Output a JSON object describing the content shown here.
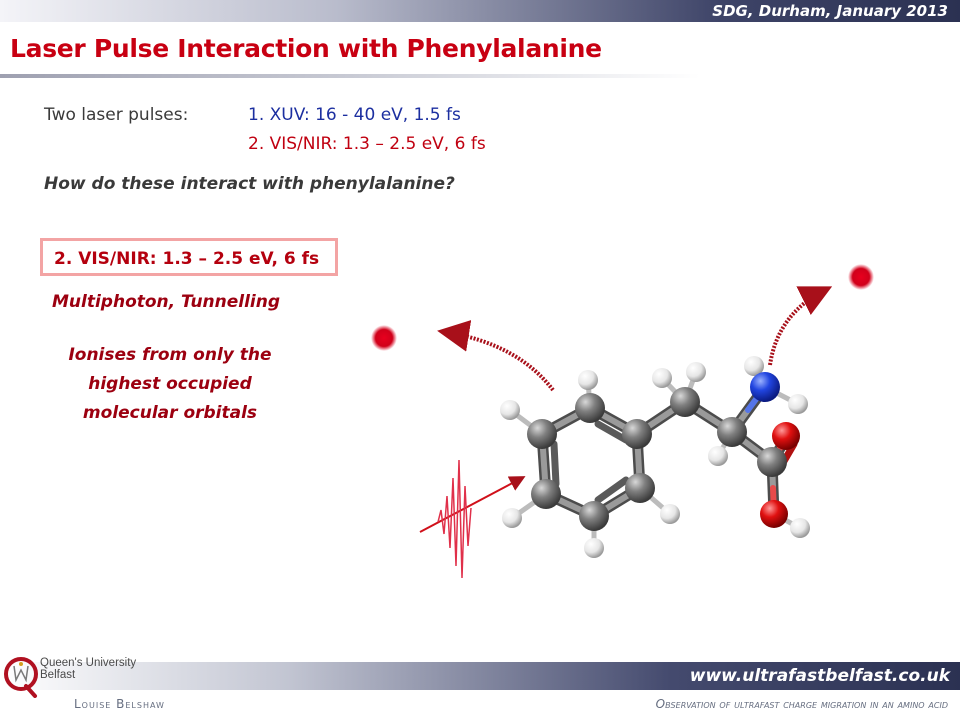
{
  "header": {
    "date_label": "SDG, Durham, January 2013"
  },
  "slide": {
    "title": "Laser Pulse Interaction with Phenylalanine",
    "pulses_label": "Two laser pulses:",
    "pulse_1": "1. XUV: 16 - 40 eV, 1.5 fs",
    "pulse_2": "2. VIS/NIR: 1.3 – 2.5 eV, 6 fs",
    "question": "How do these interact with phenylalanine?",
    "highlight": "2. VIS/NIR: 1.3 – 2.5 eV, 6 fs",
    "mechanism": "Multiphoton, Tunnelling",
    "ionises_lines": [
      "Ionises from only  the",
      "highest occupied",
      "molecular orbitals"
    ]
  },
  "footer": {
    "website": "www.ultrafastbelfast.co.uk",
    "author": "Louise Belshaw",
    "subtitle": "Observation of ultrafast charge migration in an amino acid",
    "logo_line1": "Queen's University",
    "logo_line2": "Belfast"
  },
  "colors": {
    "title_red": "#c80012",
    "xuv_blue": "#1c2fa0",
    "nir_red": "#c00010",
    "carbon": "#7a7a7a",
    "hydrogen": "#f2f2f2",
    "nitrogen": "#1f3fd8",
    "oxygen": "#e01010",
    "electron": "#d8001c",
    "arrow": "#a8101a"
  }
}
